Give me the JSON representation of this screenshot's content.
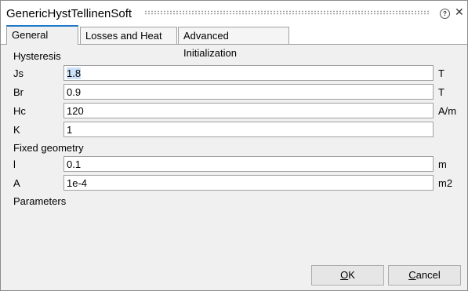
{
  "window": {
    "title": "GenericHystTellinenSoft"
  },
  "tabs": [
    {
      "label": "General",
      "active": true
    },
    {
      "label": "Losses and Heat",
      "active": false
    },
    {
      "label": "Advanced Initialization",
      "active": false
    }
  ],
  "sections": {
    "hysteresis": "Hysteresis",
    "fixed_geometry": "Fixed geometry",
    "parameters": "Parameters"
  },
  "fields": {
    "js": {
      "label": "Js",
      "value": "1.8",
      "unit": "T"
    },
    "br": {
      "label": "Br",
      "value": "0.9",
      "unit": "T"
    },
    "hc": {
      "label": "Hc",
      "value": "120",
      "unit": "A/m"
    },
    "k": {
      "label": "K",
      "value": "1",
      "unit": ""
    },
    "l": {
      "label": "l",
      "value": "0.1",
      "unit": "m"
    },
    "a": {
      "label": "A",
      "value": "1e-4",
      "unit": "m2"
    }
  },
  "buttons": {
    "ok": {
      "mnemonic": "O",
      "rest": "K"
    },
    "cancel": {
      "mnemonic": "C",
      "rest": "ancel"
    }
  },
  "icons": {
    "help": "help-icon",
    "close": "close-icon"
  },
  "colors": {
    "accent": "#1f78c8"
  }
}
